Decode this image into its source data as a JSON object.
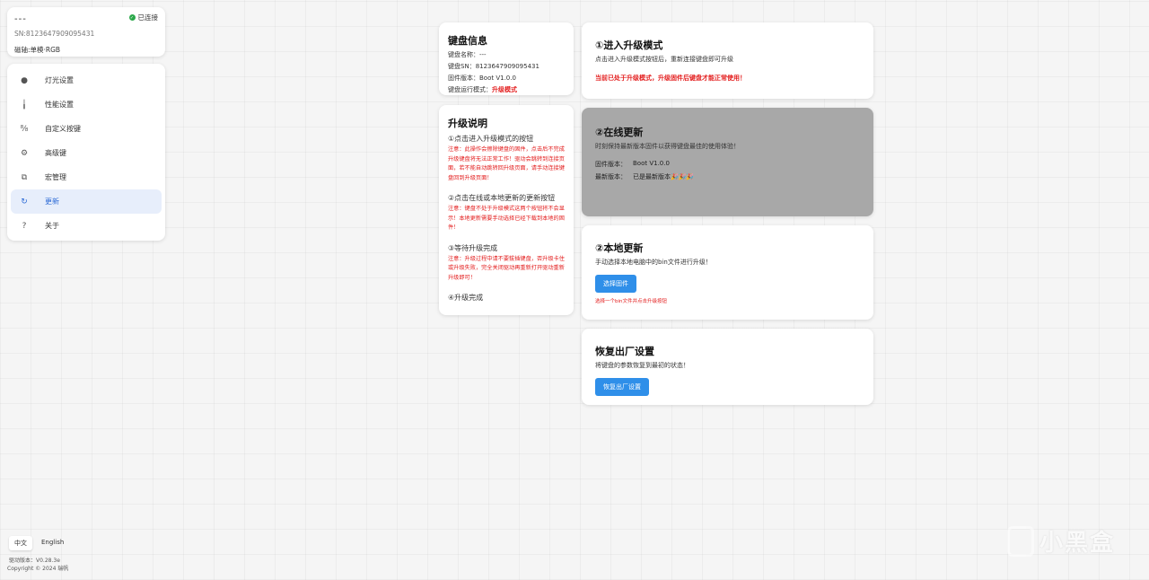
{
  "device": {
    "name": "---",
    "status": "已连接",
    "sn": "SN:8123647909095431",
    "mode": "磁轴:单模·RGB"
  },
  "nav": {
    "items": [
      {
        "label": "灯光设置",
        "icon": "bulb-icon",
        "glyph": "💡"
      },
      {
        "label": "性能设置",
        "icon": "bars-icon",
        "glyph": "⫼"
      },
      {
        "label": "自定义按键",
        "icon": "keymap-icon",
        "glyph": "⁸/₈"
      },
      {
        "label": "高级键",
        "icon": "advanced-icon",
        "glyph": "⚙"
      },
      {
        "label": "宏管理",
        "icon": "macro-icon",
        "glyph": "⧉"
      },
      {
        "label": "更新",
        "icon": "refresh-icon",
        "glyph": "↻"
      },
      {
        "label": "关于",
        "icon": "question-icon",
        "glyph": "?"
      }
    ],
    "active_index": 5
  },
  "kb_info": {
    "title": "键盘信息",
    "name_label": "键盘名称：",
    "name_value": "---",
    "sn_label": "键盘SN：",
    "sn_value": "8123647909095431",
    "fw_label": "固件版本：",
    "fw_value": "Boot V1.0.0",
    "run_label": "键盘运行模式：",
    "run_value": "升级模式"
  },
  "guide": {
    "title": "升级说明",
    "step1": "①点击进入升级模式的按钮",
    "note1": "注意：此操作会擦除键盘的固件，点击后不完成升级键盘将无法正常工作！驱动会跳转到连接页面，若不能自动跳转回升级页面，请手动连接键盘回到升级页面！",
    "step2": "②点击在线或本地更新的更新按钮",
    "note2": "注意：键盘不处于升级模式这两个按钮将不会显示！本地更新需要手动选择已经下载到本地的固件！",
    "step3": "③等待升级完成",
    "note3": "注意：升级过程中请不要拔插键盘，否升级卡住或升级失败，完全关闭驱动再重新打开驱动重新升级即可！",
    "step4": "④升级完成"
  },
  "enter_upgrade": {
    "title": "①进入升级模式",
    "desc": "点击进入升级模式按钮后，重新连接键盘即可升级",
    "warning": "当前已处于升级模式，升级固件后键盘才能正常使用！"
  },
  "online_update": {
    "title": "②在线更新",
    "desc": "时刻保持最新版本固件以获得键盘最佳的使用体验！",
    "fw_label": "固件版本：",
    "fw_value": "Boot V1.0.0",
    "latest_label": "最新版本：",
    "latest_value": "已是最新版本🎉🎉🎉"
  },
  "local_update": {
    "title": "②本地更新",
    "desc": "手动选择本地电脑中的bin文件进行升级！",
    "button": "选择固件",
    "hint": "选择一个bin文件并点击升级按钮"
  },
  "factory_reset": {
    "title": "恢复出厂设置",
    "desc": "将键盘的参数恢复到最初的状态！",
    "button": "恢复出厂设置"
  },
  "footer": {
    "lang_zh": "中文",
    "lang_en": "English",
    "driver_version": "驱动版本：V0.28.3e",
    "copyright": "Copyright © 2024 瑞帆"
  },
  "watermark": "小黑盒",
  "colors": {
    "accent": "#2f8fe9",
    "warning": "#e31c1c",
    "active_nav": "#2d6bd6",
    "disabled_card": "#a8a8a8"
  }
}
